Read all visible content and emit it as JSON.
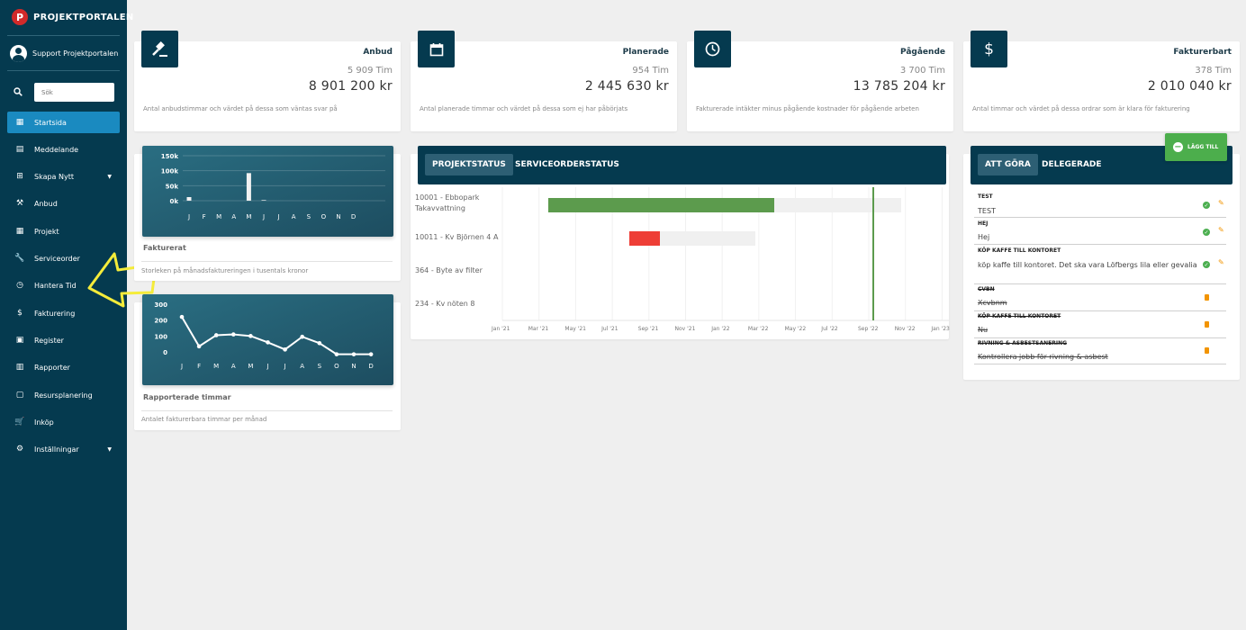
{
  "brand": {
    "name": "PROJEKTPORTALEN",
    "logo_letter": "P"
  },
  "user": {
    "name": "Support Projektportalen"
  },
  "search": {
    "placeholder": "Sök"
  },
  "sidebar": {
    "items": [
      {
        "label": "Startsida",
        "icon": "dashboard-icon",
        "active": true
      },
      {
        "label": "Meddelande",
        "icon": "message-icon"
      },
      {
        "label": "Skapa Nytt",
        "icon": "add-box-icon",
        "has_submenu": true
      },
      {
        "label": "Anbud",
        "icon": "gavel-icon"
      },
      {
        "label": "Projekt",
        "icon": "grid-icon"
      },
      {
        "label": "Serviceorder",
        "icon": "wrench-icon"
      },
      {
        "label": "Hantera Tid",
        "icon": "clock-icon"
      },
      {
        "label": "Fakturering",
        "icon": "dollar-icon"
      },
      {
        "label": "Register",
        "icon": "image-icon"
      },
      {
        "label": "Rapporter",
        "icon": "calendar-icon"
      },
      {
        "label": "Resursplanering",
        "icon": "calendar-icon"
      },
      {
        "label": "Inköp",
        "icon": "cart-icon"
      },
      {
        "label": "Inställningar",
        "icon": "gear-icon",
        "has_submenu": true
      }
    ]
  },
  "stats": [
    {
      "title": "Anbud",
      "hours": "5 909 Tim",
      "value": "8 901 200 kr",
      "desc": "Antal anbudstimmar och värdet på dessa som väntas svar på",
      "icon": "gavel-icon"
    },
    {
      "title": "Planerade",
      "hours": "954 Tim",
      "value": "2 445 630 kr",
      "desc": "Antal planerade timmar och värdet på dessa som ej har påbörjats",
      "icon": "calendar-icon"
    },
    {
      "title": "Pågående",
      "hours": "3 700 Tim",
      "value": "13 785 204 kr",
      "desc": "Fakturerade intäkter minus pågående kostnader för pågående arbeten",
      "icon": "clock-icon"
    },
    {
      "title": "Fakturerbart",
      "hours": "378 Tim",
      "value": "2 010 040 kr",
      "desc": "Antal timmar och värdet på dessa ordrar som är klara för fakturering",
      "icon": "dollar-icon"
    }
  ],
  "fakturerat": {
    "caption": "Fakturerat",
    "subtitle": "Storleken på månadsfaktureringen i tusentals kronor"
  },
  "rapporterade": {
    "caption": "Rapporterade timmar",
    "subtitle": "Antalet fakturerbara timmar per månad"
  },
  "chart_data": [
    {
      "type": "bar",
      "categories": [
        "J",
        "F",
        "M",
        "A",
        "M",
        "J",
        "J",
        "A",
        "S",
        "O",
        "N",
        "D"
      ],
      "values": [
        12,
        0,
        0,
        0,
        92,
        2,
        0,
        0,
        0,
        0,
        0,
        0
      ],
      "yticks": [
        "150k",
        "100k",
        "50k",
        "0k"
      ],
      "ylim": [
        0,
        150
      ]
    },
    {
      "type": "line",
      "categories": [
        "J",
        "F",
        "M",
        "A",
        "M",
        "J",
        "J",
        "A",
        "S",
        "O",
        "N",
        "D"
      ],
      "values": [
        220,
        35,
        105,
        110,
        100,
        60,
        15,
        95,
        55,
        -15,
        -15,
        -15
      ],
      "yticks": [
        "300",
        "200",
        "100",
        "0"
      ],
      "ylim": [
        0,
        300
      ]
    }
  ],
  "project_panel": {
    "tabs": [
      "PROJEKTSTATUS",
      "SERVICEORDERSTATUS"
    ],
    "rows": [
      "10001 - Ebbopark Takavvattning",
      "10011 - Kv Björnen 4 A",
      "364 - Byte av filter",
      "234 - Kv nöten 8"
    ],
    "months": [
      "Jan '21",
      "Mar '21",
      "May '21",
      "Jul '21",
      "Sep '21",
      "Nov '21",
      "Jan '22",
      "Mar '22",
      "May '22",
      "Jul '22",
      "Sep '22",
      "Nov '22",
      "Jan '23"
    ]
  },
  "todo_panel": {
    "tabs": [
      "ATT GÖRA",
      "DELEGERADE"
    ],
    "add_label": "LÄGG TILL",
    "items": [
      {
        "title": "TEST",
        "text": "TEST",
        "done": false
      },
      {
        "title": "HEJ",
        "text": "Hej",
        "done": false
      },
      {
        "title": "KÖP KAFFE TILL KONTORET",
        "text": "köp kaffe till kontoret. Det ska vara Löfbergs lila eller gevalia",
        "done": false
      },
      {
        "title": "CVBN",
        "text": "Xcvbnm",
        "done": true
      },
      {
        "title": "KÖP KAFFE TILL KONTORET",
        "text": "Nu",
        "done": true
      },
      {
        "title": "RIVNING & ASBESTSANERING",
        "text": "Kontrollera jobb för rivning & asbest",
        "done": true
      }
    ]
  }
}
